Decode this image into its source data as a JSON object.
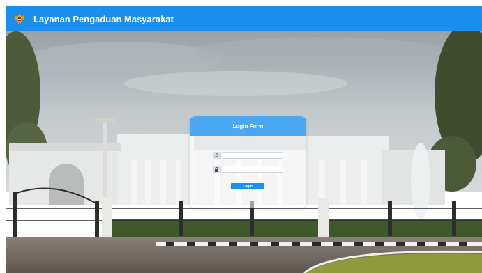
{
  "header": {
    "title": "Layanan Pengaduan Masyarakat",
    "logo_icon": "garuda-emblem-icon",
    "background": "#1a8ff0"
  },
  "background_image": {
    "subject": "presidential palace with fountain"
  },
  "login_form": {
    "title": "Login Form",
    "username": {
      "icon": "user-icon",
      "value": "",
      "placeholder": ""
    },
    "password": {
      "icon": "lock-icon",
      "value": "",
      "placeholder": ""
    },
    "submit_label": "Login",
    "accent": "#1a8ff0",
    "header_color": "#4aa8f2"
  }
}
